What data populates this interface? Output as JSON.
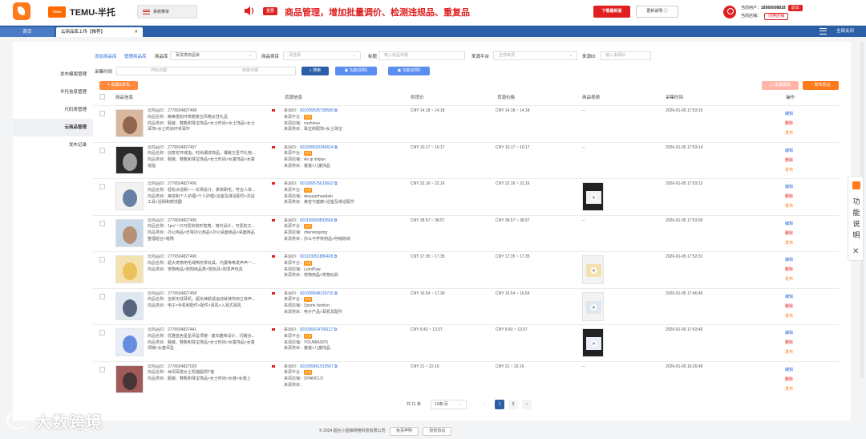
{
  "header": {
    "brand_badge": "TEMU",
    "brand_name": "TEMU-半托",
    "system_menu": "系统菜单",
    "notice_tag": "重要",
    "notice": "商品管理，增加批量调价、检测违规品、重复品",
    "download_btn": "下载最新版",
    "update_btn": "更新说明 ⓘ",
    "user_label": "当前用户：",
    "user_phone": "18560008818",
    "logout": "退出",
    "store_label": "当前店铺：",
    "switch_store": "切换店铺"
  },
  "tabs": {
    "home": "首页",
    "current": "云商品库上传【推荐】",
    "close_all": "全部关闭"
  },
  "sidebar": {
    "items": [
      {
        "label": "发布模版管理"
      },
      {
        "label": "半托信息管理"
      },
      {
        "label": "尺码表管理"
      },
      {
        "label": "云商品管理"
      },
      {
        "label": "发布记录"
      }
    ]
  },
  "filters": {
    "add_product": "添加商品库",
    "manage_product": "管理商品库",
    "lib_label": "商品库",
    "lib_value": "百货类商品库",
    "cat_label": "商品类目",
    "cat_placeholder": "请选择",
    "title_label": "标题",
    "title_placeholder": "输入商品标题",
    "source_label": "来源平台",
    "source_value": "全部来源",
    "sourceid_label": "来源ID",
    "sourceid_placeholder": "输入来源ID",
    "time_label": "采集时间",
    "start_placeholder": "开始日期",
    "range_sep": "-",
    "end_placeholder": "结束日期",
    "search_btn": "搜索",
    "help1_btn": "功能说明1",
    "help2_btn": "功能说明2",
    "collect_btn": "采集&发布",
    "batch_delete_btn": "批量删除",
    "publish_btn": "发布商品"
  },
  "table": {
    "headers": [
      "商品信息",
      "货源信息",
      "供货价",
      "货源价格",
      "商品视频",
      "采集时间",
      "操作"
    ],
    "labels": {
      "cloud_id": "云商品ID：",
      "name": "商品名称：",
      "category": "商品类目：",
      "source_id": "来源ID：",
      "source_platform": "来源平台：",
      "source_store": "来源店铺：",
      "source_category": "来源类目：",
      "auto": "自动",
      "edit": "编辑",
      "delete": "删除",
      "publish": "发布"
    },
    "rows": [
      {
        "cid": "2776504827498",
        "name": "精美搭扣环表腕复古风格女性礼品",
        "cat1": "服装、鞋靴和珠宝饰品>女士时尚>女士饰品>女士",
        "cat2": "耳饰>女士时尚环状耳环",
        "sid": "601099535795589",
        "store": "xuzhinuo",
        "scat": "珠宝和配饰>女士珠宝",
        "supply": "CNY 14.18 ~ 14.18",
        "price": "CNY 14.18 ~ 14.18",
        "video": "--",
        "time": "2026-01-05 17:53:16"
      },
      {
        "cid": "2776504827497",
        "name": "创意花环戒指，时尚潮流饰品，镶嵌万圣节礼物...",
        "cat1": "服装、鞋靴和珠宝饰品>女士时尚>女童饰品>女童",
        "cat2": "戒指",
        "sid": "601099533349624",
        "store": "An qi shijian",
        "scat": "童装>儿童饰品",
        "supply": "CNY 10.17 ~ 10.17",
        "price": "CNY 10.17 ~ 10.17",
        "video": "--",
        "time": "2026-01-05 17:53:14"
      },
      {
        "cid": "2776504827496",
        "name": "轻松冰浴刷——长柄设计，柔软刷毛，符合人体...",
        "cat1": "美容和个人护理>个人护理>浴室及淋浴配件>沐浴",
        "cat2": "工具>浴刷和擦洗器",
        "sid": "601099575610602",
        "store": "deuuyerhaodain",
        "scat": "美容与健康>浴室及淋浴配件",
        "supply": "CNY 22.16 ~ 22.16",
        "price": "CNY 22.16 ~ 22.16",
        "video": "",
        "time": "2026-01-05 17:53:12"
      },
      {
        "cid": "2776504827495",
        "name": "1pc/一只可爱的狗形笔筒，简约设计，可爱的文...",
        "cat1": "办公用品>日常办公用品>办公桌面用品>桌面用品",
        "cat2": "整理组合>笔筒",
        "sid": "601100569833569",
        "store": "zhenxingxing",
        "scat": "办公与学校用品>存储收纳",
        "supply": "CNY 38.57 ~ 38.57",
        "price": "CNY 38.57 ~ 38.57",
        "video": "--",
        "time": "2026-01-05 17:53:09"
      },
      {
        "cid": "2776504827490",
        "name": "超大宠物用毛绒鸭形拼玩具，内置啾啾发声声一...",
        "cat1": "宠物用品>狗狗用品类>狗玩具>狗发声玩具",
        "cat2": "",
        "sid": "601103051880428",
        "store": "LumiPaw",
        "scat": "宠物用品>宠物玩具",
        "supply": "CNY 17.35 ~ 17.35",
        "price": "CNY 17.35 ~ 17.35",
        "video": "",
        "time": "2026-01-05 17:52:31"
      },
      {
        "cid": "2776504827458",
        "name": "全新无线耳机，超长续航适运动就读你双立体声...",
        "cat1": "电子>手机和配件>配件>耳机>入耳式耳机",
        "cat2": "",
        "sid": "601099548120716",
        "store": "Sports fashion",
        "scat": "电子产品>耳机及配件",
        "supply": "CNY 16.54 ~ 17.39",
        "price": "CNY 16.54 ~ 16.54",
        "video": "",
        "time": "2026-01-05 17:46:45"
      },
      {
        "cid": "2776504827441",
        "name": "优雅蓝色星星吊坠项链 - 童年趣味设计，闪耀点...",
        "cat1": "服装、鞋靴和珠宝饰品>女士时尚>女童饰品>女童",
        "cat2": "项链>女童吊坠",
        "sid": "601099914790117",
        "store": "YOUMIASPD",
        "scat": "童装>儿童饰品",
        "supply": "CNY 8.43 ~ 13.07",
        "price": "CNY 8.43 ~ 13.07",
        "video": "",
        "time": "2026-01-05 17:43:46"
      },
      {
        "cid": "2776504827029",
        "name": "休闲百搭女士短袖圆领T恤",
        "cat1": "服装、鞋靴和珠宝饰品>女士时尚>女装>女装上",
        "cat2": "",
        "sid": "601099961913567",
        "store": "SHANCLO",
        "scat": "",
        "supply": "CNY 21 ~ 22.16",
        "price": "CNY 21 ~ 22.16",
        "video": "--",
        "time": "2026-01-05 16:26:48"
      }
    ]
  },
  "pager": {
    "total": "共 11 条",
    "page_size": "10条/页",
    "prev": "‹",
    "page1": "1",
    "page2": "2",
    "next": "›"
  },
  "footer": {
    "copyright": "© 2024 烟台小蓝鲸网络科技有限公司",
    "disclaimer": "免责声明",
    "license": "授权协议"
  },
  "float": {
    "text": "功能说明",
    "close": "✕"
  },
  "watermark": "大数跨境",
  "colors": {
    "accent": "#2b5fa7",
    "brand": "#ff6a00",
    "danger": "#e02020",
    "link": "#2b6cd9"
  }
}
